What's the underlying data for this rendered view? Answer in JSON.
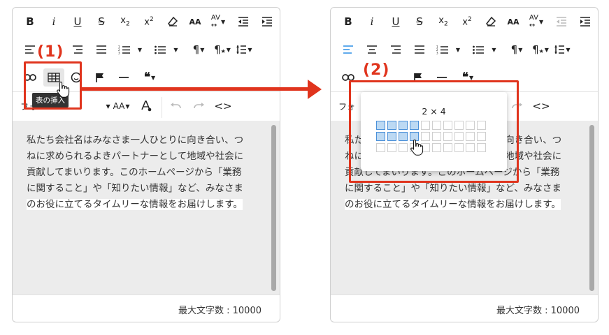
{
  "toolbar": {
    "bold": "B",
    "italic": "i",
    "underline": "U",
    "undo_icon": "undo-icon",
    "redo_icon": "redo-icon",
    "code_view": "<>",
    "paragraph": "¶",
    "quote": "66",
    "font_label": "フォ"
  },
  "step1": {
    "label": "(1)",
    "tooltip": "表の挿入"
  },
  "step2": {
    "label": "(2)",
    "grid_size": "2 × 4",
    "selected_rows": 2,
    "selected_cols": 4,
    "total_rows": 3,
    "total_cols": 10
  },
  "content": {
    "lines": [
      "私たち会社名はみなさま一人ひとりに向き合い、つ",
      "ねに求められるよきパートナーとして地域や社会に",
      "貢献してまいります。このホームページから「業務",
      "に関すること」や「知りたい情報」など、みなさま",
      "のお役に立てるタイムリーな情報をお届けします。"
    ]
  },
  "footer": {
    "max_chars": "最大文字数 : 10000"
  },
  "colors": {
    "highlight": "#e0341d",
    "selected_cell": "#bcd9f3",
    "align_active": "#2b8fe5"
  }
}
